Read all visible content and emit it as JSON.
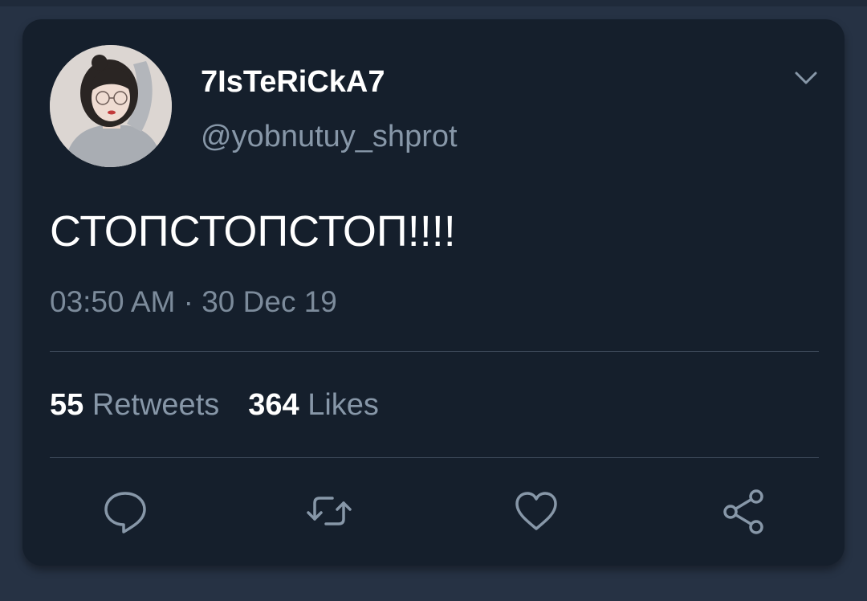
{
  "tweet": {
    "display_name": "7IsTeRiCkA7",
    "handle": "@yobnutuy_shprot",
    "text": "СТОПСТОПСТОП!!!!",
    "timestamp": "03:50 AM · 30 Dec 19",
    "retweets_count": "55",
    "retweets_label": "Retweets",
    "likes_count": "364",
    "likes_label": "Likes"
  },
  "icons": {
    "menu": "chevron-down-icon",
    "reply": "comment-icon",
    "retweet": "retweet-icon",
    "like": "heart-icon",
    "share": "share-icon"
  },
  "colors": {
    "background": "#263244",
    "card": "#151f2c",
    "primary_text": "#ffffff",
    "secondary_text": "#8797a8",
    "divider": "#3a4656"
  }
}
